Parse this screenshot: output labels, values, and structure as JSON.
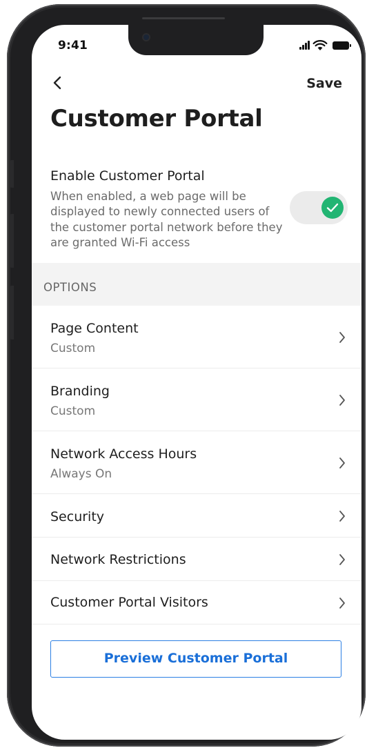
{
  "status_bar": {
    "time": "9:41",
    "icons": [
      "signal-icon",
      "wifi-icon",
      "battery-icon"
    ]
  },
  "nav": {
    "back_icon": "chevron-left-icon",
    "save_label": "Save"
  },
  "page": {
    "title": "Customer Portal"
  },
  "enable_portal": {
    "title": "Enable Customer Portal",
    "description": "When enabled, a web page will be displayed to newly connected users of the customer portal network before they are granted Wi-Fi access",
    "enabled": true
  },
  "options": {
    "header": "OPTIONS",
    "items": [
      {
        "title": "Page Content",
        "subtitle": "Custom"
      },
      {
        "title": "Branding",
        "subtitle": "Custom"
      },
      {
        "title": "Network Access Hours",
        "subtitle": "Always On"
      },
      {
        "title": "Security"
      },
      {
        "title": "Network Restrictions"
      },
      {
        "title": "Customer Portal Visitors"
      }
    ]
  },
  "preview_button": {
    "label": "Preview Customer Portal"
  },
  "colors": {
    "toggle_on": "#22b573",
    "accent_blue": "#1a6fd8",
    "section_bg": "#f3f3f3"
  }
}
